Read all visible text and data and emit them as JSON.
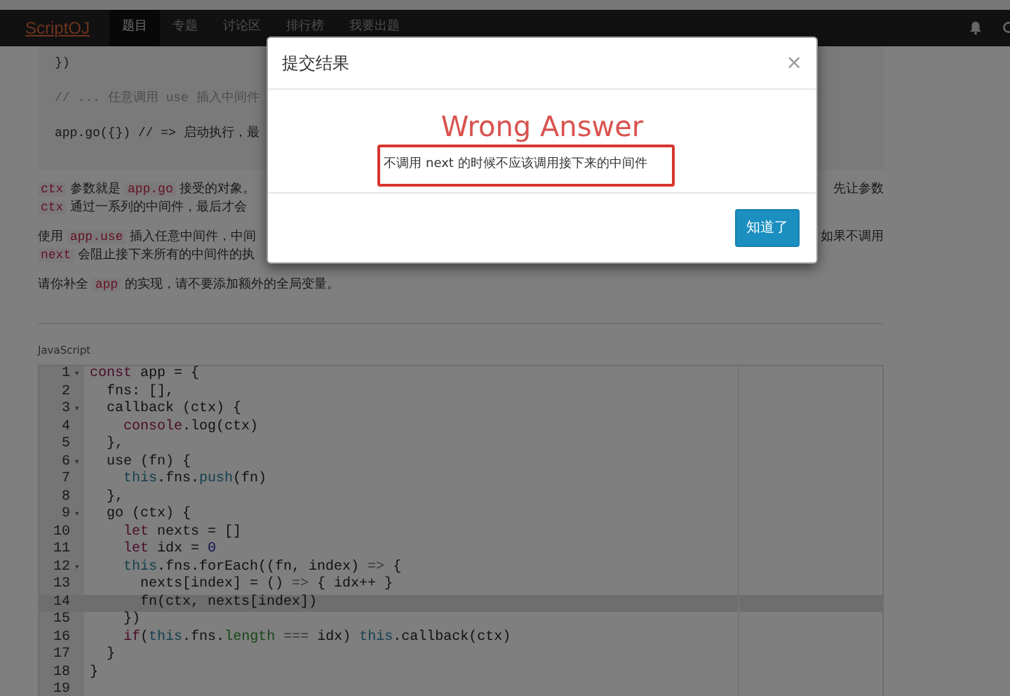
{
  "navbar": {
    "brand": "ScriptOJ",
    "items": [
      {
        "label": "题目",
        "selected": true
      },
      {
        "label": "专题",
        "selected": false
      },
      {
        "label": "讨论区",
        "selected": false
      },
      {
        "label": "排行榜",
        "selected": false
      },
      {
        "label": "我要出题",
        "selected": false
      }
    ]
  },
  "problem": {
    "snippet": [
      "})",
      "// ... 任意调用 use 插入中间件",
      "app.go({}) // => 启动执行，最"
    ],
    "paragraphs": [
      {
        "lines": [
          {
            "left": [
              {
                "kind": "code",
                "text": "ctx"
              },
              {
                "kind": "text",
                "text": " 参数就是 "
              },
              {
                "kind": "code",
                "text": "app.go"
              },
              {
                "kind": "text",
                "text": " 接受的对象。"
              }
            ],
            "right": "先让参数"
          },
          {
            "left": [
              {
                "kind": "code",
                "text": "ctx"
              },
              {
                "kind": "text",
                "text": " 通过一系列的中间件，最后才会"
              }
            ]
          }
        ]
      },
      {
        "lines": [
          {
            "left": [
              {
                "kind": "text",
                "text": "使用 "
              },
              {
                "kind": "code",
                "text": "app.use"
              },
              {
                "kind": "text",
                "text": " 插入任意中间件，中间"
              }
            ],
            "right": "如果不调用"
          },
          {
            "left": [
              {
                "kind": "code",
                "text": "next"
              },
              {
                "kind": "text",
                "text": " 会阻止接下来所有的中间件的执"
              }
            ]
          }
        ]
      },
      {
        "lines": [
          {
            "left": [
              {
                "kind": "text",
                "text": "请你补全 "
              },
              {
                "kind": "code",
                "text": "app"
              },
              {
                "kind": "text",
                "text": " 的实现，请不要添加额外的全局变量。"
              }
            ]
          }
        ]
      }
    ]
  },
  "editor": {
    "language": "JavaScript",
    "lines": [
      {
        "number": "1",
        "fold": "▾",
        "highlighted": false,
        "tokens": [
          {
            "kind": "kw",
            "text": "const"
          },
          {
            "kind": "plain",
            "text": " app = {"
          }
        ]
      },
      {
        "number": "2",
        "highlighted": false,
        "tokens": [
          {
            "kind": "plain",
            "text": "  fns: [],"
          }
        ]
      },
      {
        "number": "3",
        "fold": "▾",
        "highlighted": false,
        "tokens": [
          {
            "kind": "plain",
            "text": "  callback (ctx) {"
          }
        ]
      },
      {
        "number": "4",
        "highlighted": false,
        "tokens": [
          {
            "kind": "kw",
            "text": "    console"
          },
          {
            "kind": "plain",
            "text": ".log(ctx)"
          }
        ]
      },
      {
        "number": "5",
        "highlighted": false,
        "tokens": [
          {
            "kind": "plain",
            "text": "  },"
          }
        ]
      },
      {
        "number": "6",
        "fold": "▾",
        "highlighted": false,
        "tokens": [
          {
            "kind": "plain",
            "text": "  use (fn) {"
          }
        ]
      },
      {
        "number": "7",
        "highlighted": false,
        "tokens": [
          {
            "kind": "this",
            "text": "    this"
          },
          {
            "kind": "plain",
            "text": ".fns."
          },
          {
            "kind": "this",
            "text": "push"
          },
          {
            "kind": "plain",
            "text": "(fn)"
          }
        ]
      },
      {
        "number": "8",
        "highlighted": false,
        "tokens": [
          {
            "kind": "plain",
            "text": "  },"
          }
        ]
      },
      {
        "number": "9",
        "fold": "▾",
        "highlighted": false,
        "tokens": [
          {
            "kind": "plain",
            "text": "  go (ctx) {"
          }
        ]
      },
      {
        "number": "10",
        "highlighted": false,
        "tokens": [
          {
            "kind": "kw",
            "text": "    let"
          },
          {
            "kind": "plain",
            "text": " nexts = []"
          }
        ]
      },
      {
        "number": "11",
        "highlighted": false,
        "tokens": [
          {
            "kind": "kw",
            "text": "    let"
          },
          {
            "kind": "plain",
            "text": " idx = "
          },
          {
            "kind": "num",
            "text": "0"
          }
        ]
      },
      {
        "number": "12",
        "fold": "▾",
        "highlighted": false,
        "tokens": [
          {
            "kind": "this",
            "text": "    this"
          },
          {
            "kind": "plain",
            "text": ".fns.forEach((fn, index) "
          },
          {
            "kind": "op",
            "text": "=>"
          },
          {
            "kind": "plain",
            "text": " {"
          }
        ]
      },
      {
        "number": "13",
        "highlighted": false,
        "tokens": [
          {
            "kind": "plain",
            "text": "      nexts[index] = () "
          },
          {
            "kind": "op",
            "text": "=>"
          },
          {
            "kind": "plain",
            "text": " { idx++ }"
          }
        ]
      },
      {
        "number": "14",
        "highlighted": true,
        "tokens": [
          {
            "kind": "plain",
            "text": "      fn(ctx, nexts[index])"
          }
        ]
      },
      {
        "number": "15",
        "highlighted": false,
        "tokens": [
          {
            "kind": "plain",
            "text": "    })"
          }
        ]
      },
      {
        "number": "16",
        "highlighted": false,
        "tokens": [
          {
            "kind": "kw",
            "text": "    if"
          },
          {
            "kind": "plain",
            "text": "("
          },
          {
            "kind": "this",
            "text": "this"
          },
          {
            "kind": "plain",
            "text": ".fns."
          },
          {
            "kind": "prop",
            "text": "length"
          },
          {
            "kind": "op",
            "text": " === "
          },
          {
            "kind": "plain",
            "text": "idx) "
          },
          {
            "kind": "this",
            "text": "this"
          },
          {
            "kind": "plain",
            "text": ".callback(ctx)"
          }
        ]
      },
      {
        "number": "17",
        "highlighted": false,
        "tokens": [
          {
            "kind": "plain",
            "text": "  }"
          }
        ]
      },
      {
        "number": "18",
        "highlighted": false,
        "tokens": [
          {
            "kind": "plain",
            "text": "}"
          }
        ]
      },
      {
        "number": "19",
        "highlighted": false
      }
    ]
  },
  "modal": {
    "title": "提交结果",
    "close": "×",
    "verdict": "Wrong Answer",
    "message": "不调用 next 的时候不应该调用接下来的中间件",
    "button": "知道了"
  }
}
